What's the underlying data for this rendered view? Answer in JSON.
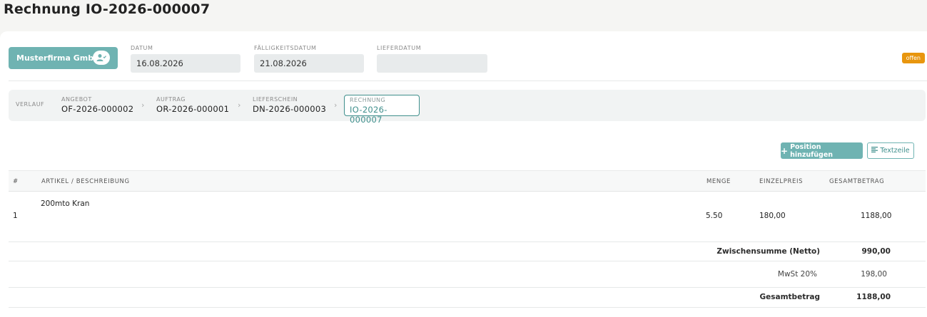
{
  "page": {
    "title": "Rechnung IO-2026-000007"
  },
  "header": {
    "customer_button": "Musterfirma GmbH",
    "fields": {
      "datum_label": "DATUM",
      "datum_value": "16.08.2026",
      "faelligkeit_label": "FÄLLIGKEITSDATUM",
      "faelligkeit_value": "21.08.2026",
      "lieferdatum_label": "LIEFERDATUM",
      "lieferdatum_value": ""
    },
    "status": "offen"
  },
  "workflow": {
    "label": "VERLAUF",
    "steps": [
      {
        "label": "ANGEBOT",
        "value": "OF-2026-000002"
      },
      {
        "label": "AUFTRAG",
        "value": "OR-2026-000001"
      },
      {
        "label": "LIEFERSCHEIN",
        "value": "DN-2026-000003"
      },
      {
        "label": "RECHNUNG",
        "value": "IO-2026-000007"
      }
    ]
  },
  "actions": {
    "add_position": "Position hinzufügen",
    "text_line": "Textzeile"
  },
  "table": {
    "headers": {
      "num": "#",
      "article": "ARTIKEL / BESCHREIBUNG",
      "quantity": "MENGE",
      "unit_price": "EINZELPREIS",
      "total": "GESAMTBETRAG"
    },
    "rows": [
      {
        "num": "1",
        "article": "200mto Kran",
        "quantity": "5.50",
        "unit_price": "180,00",
        "total": "1188,00"
      }
    ]
  },
  "totals": {
    "subtotal_label": "Zwischensumme (Netto)",
    "subtotal_value": "990,00",
    "tax_label": "MwSt 20%",
    "tax_value": "198,00",
    "grand_label": "Gesamtbetrag",
    "grand_value": "1188,00"
  },
  "colors": {
    "accent": "#6fb3b2",
    "accent_dark": "#3f8f8c",
    "status_open": "#e8960e"
  }
}
